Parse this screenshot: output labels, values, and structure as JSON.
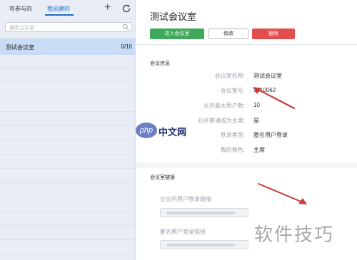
{
  "left_panel": {
    "tabs": [
      "可参与的",
      "我创建的"
    ],
    "search_placeholder": "搜索会议室",
    "rooms": [
      {
        "name": "测试会议室",
        "count": "0/10"
      }
    ]
  },
  "room": {
    "title": "测试会议室",
    "buttons": {
      "enter": "进入会议室",
      "edit": "修改",
      "delete": "删除"
    },
    "info_section_title": "会议信息",
    "info": [
      {
        "label": "会议室名称:",
        "value": "测试会议室"
      },
      {
        "label": "会议室号:",
        "value": "3510062"
      },
      {
        "label": "允许最大用户数:",
        "value": "10"
      },
      {
        "label": "允许普通成为主席:",
        "value": "是"
      },
      {
        "label": "登录类型:",
        "value": "匿名用户登录"
      },
      {
        "label": "我的角色:",
        "value": "主席"
      }
    ],
    "link_section_title": "会议室链接",
    "links": [
      {
        "label": "企业内用户登录链接"
      },
      {
        "label": "匿名用户登录链接"
      }
    ]
  },
  "watermarks": {
    "php_logo": "php",
    "php_text": "中文网",
    "corner_text": "软件技巧"
  },
  "colors": {
    "accent_blue": "#1f6fc9",
    "enter_green": "#3fa95b",
    "delete_red": "#e24e4e",
    "selected_row": "#c9dcf5",
    "arrow_red": "#c93a3a"
  },
  "icons": {
    "add": "plus-icon",
    "refresh": "refresh-icon",
    "search": "search-icon"
  }
}
